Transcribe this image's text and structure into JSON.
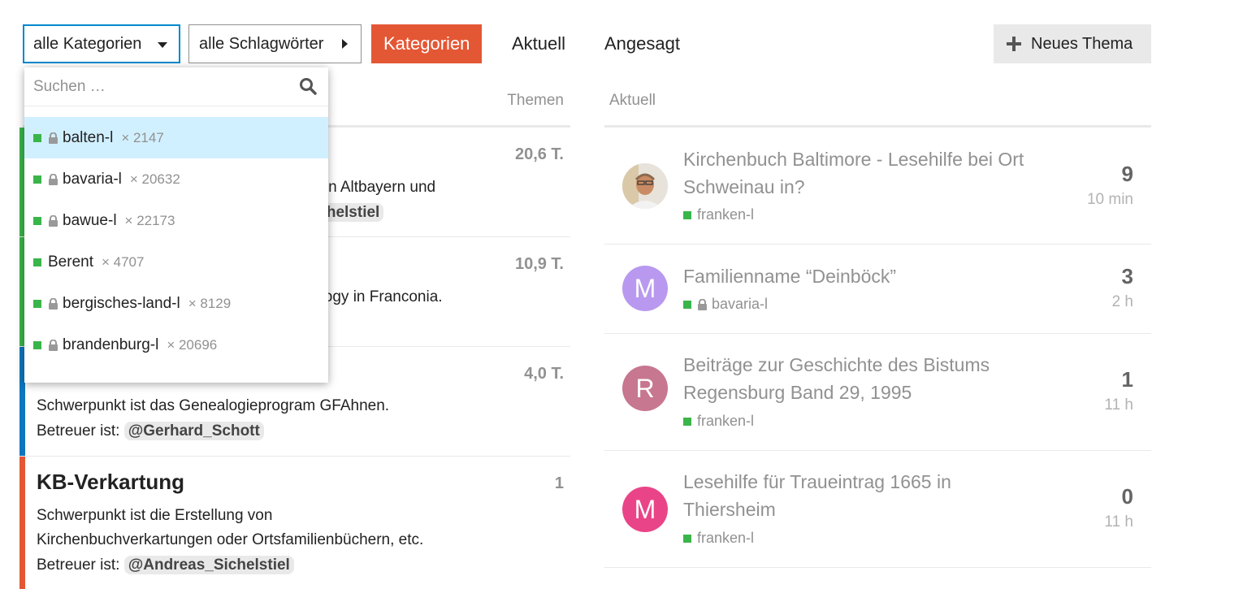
{
  "nav": {
    "category_dropdown": "alle Kategorien",
    "tags_dropdown": "alle Schlagwörter",
    "tabs": [
      {
        "label": "Kategorien",
        "active": true
      },
      {
        "label": "Aktuell",
        "active": false
      },
      {
        "label": "Angesagt",
        "active": false
      }
    ],
    "new_topic": "Neues Thema"
  },
  "categories": {
    "header_topics": "Themen",
    "rows": [
      {
        "count": "20,6 T.",
        "desc_tail": "g in Altbayern und",
        "mention_tail": "ichelstiel",
        "color": "#3ab54a"
      },
      {
        "count": "10,9 T.",
        "desc_tail": "alogy in Franconia.",
        "color": "#3ab54a"
      },
      {
        "count": "4,0 T.",
        "desc1": "Schwerpunkt ist das Genealogieprogram GFAhnen.",
        "desc2_prefix": "Betreuer ist:",
        "mention": "@Gerhard_Schott",
        "color": "#0e76bd"
      },
      {
        "name": "KB-Verkartung",
        "count": "1",
        "desc1": "Schwerpunkt ist die Erstellung von",
        "desc2": "Kirchenbuchverkartungen oder Ortsfamilienbüchern, etc.",
        "desc3_prefix": "Betreuer ist:",
        "mention": "@Andreas_Sichelstiel",
        "color": "#e45735"
      }
    ]
  },
  "dropdown": {
    "search_placeholder": "Suchen …",
    "options": [
      {
        "label": "balten-l",
        "count": "× 2147",
        "locked": true
      },
      {
        "label": "bavaria-l",
        "count": "× 20632",
        "locked": true
      },
      {
        "label": "bawue-l",
        "count": "× 22173",
        "locked": true
      },
      {
        "label": "Berent",
        "count": "× 4707",
        "locked": false
      },
      {
        "label": "bergisches-land-l",
        "count": "× 8129",
        "locked": true
      },
      {
        "label": "brandenburg-l",
        "count": "× 20696",
        "locked": true
      }
    ],
    "tag_color": "#3ab54a"
  },
  "latest": {
    "header": "Aktuell",
    "topics": [
      {
        "title": "Kirchenbuch Baltimore - Lesehilfe bei Ort Schweinau in?",
        "tag": "franken-l",
        "locked": false,
        "replies": "9",
        "age": "10 min",
        "avatar_letter": "",
        "avatar_color": "#c9a27a"
      },
      {
        "title": "Familienname “Deinböck”",
        "tag": "bavaria-l",
        "locked": true,
        "replies": "3",
        "age": "2 h",
        "avatar_letter": "M",
        "avatar_color": "#b899ef"
      },
      {
        "title": "Beiträge zur Geschichte des Bistums Regensburg Band 29, 1995",
        "tag": "franken-l",
        "locked": false,
        "replies": "1",
        "age": "11 h",
        "avatar_letter": "R",
        "avatar_color": "#c77790"
      },
      {
        "title": "Lesehilfe für Traueintrag 1665 in Thiersheim",
        "tag": "franken-l",
        "locked": false,
        "replies": "0",
        "age": "11 h",
        "avatar_letter": "M",
        "avatar_color": "#ea4489"
      }
    ]
  }
}
